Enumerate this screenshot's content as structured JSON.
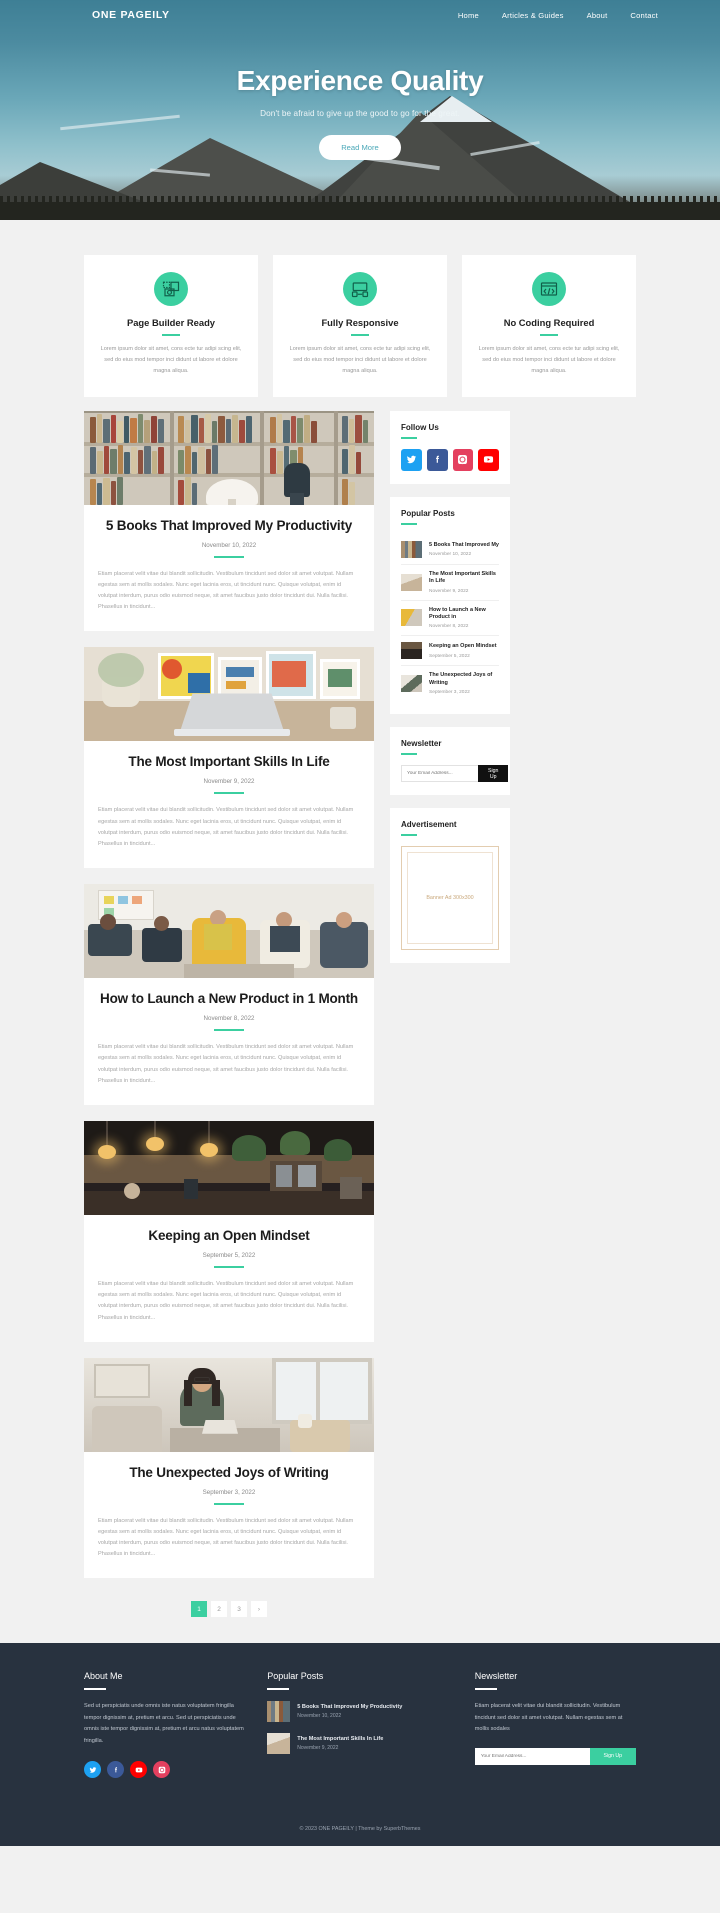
{
  "site": {
    "brand": "ONE PAGEILY"
  },
  "nav": {
    "items": [
      {
        "label": "Home"
      },
      {
        "label": "Articles & Guides"
      },
      {
        "label": "About"
      },
      {
        "label": "Contact"
      }
    ]
  },
  "hero": {
    "title": "Experience Quality",
    "subtitle": "Don't be afraid to give up the good to go for the great.",
    "button": "Read More"
  },
  "features": [
    {
      "icon": "page-builder-icon",
      "title": "Page Builder Ready",
      "text": "Lorem ipsum dolor sit amet, cons ecte tur adipi scing elit, sed do eius mod tempor inci didunt ut labore et dolore magna aliqua."
    },
    {
      "icon": "responsive-devices-icon",
      "title": "Fully Responsive",
      "text": "Lorem ipsum dolor sit amet, cons ecte tur adipi scing elit, sed do eius mod tempor inci didunt ut labore et dolore magna aliqua."
    },
    {
      "icon": "no-code-icon",
      "title": "No Coding Required",
      "text": "Lorem ipsum dolor sit amet, cons ecte tur adipi scing elit, sed do eius mod tempor inci didunt ut labore et dolore magna aliqua."
    }
  ],
  "excerpt": "Etiam placerat velit vitae dui blandit sollicitudin. Vestibulum tincidunt sed dolor sit amet volutpat. Nullam egestas sem at mollis sodales. Nunc eget lacinia eros, ut tincidunt nunc. Quisque volutpat, enim id volutpat interdum, purus odio euismod neque, sit amet faucibus justo dolor tincidunt dui. Nulla facilisi. Phasellus in tincidunt...",
  "posts": [
    {
      "title": "5 Books That Improved My Productivity",
      "date": "November 10, 2022",
      "image": "bookshelf-library-photo"
    },
    {
      "title": "The Most Important Skills In Life",
      "date": "November 9, 2022",
      "image": "desk-laptop-artwork-photo"
    },
    {
      "title": "How to Launch a New Product in 1 Month",
      "date": "November 8, 2022",
      "image": "team-meeting-office-photo"
    },
    {
      "title": "Keeping an Open Mindset",
      "date": "September 5, 2022",
      "image": "cafe-interior-photo"
    },
    {
      "title": "The Unexpected Joys of Writing",
      "date": "September 3, 2022",
      "image": "woman-writing-desk-photo"
    }
  ],
  "pagination": {
    "pages": [
      "1",
      "2",
      "3",
      "›"
    ],
    "active": "1"
  },
  "sidebar": {
    "follow": {
      "title": "Follow Us",
      "socials": [
        {
          "name": "twitter-icon",
          "color": "#1da1f2"
        },
        {
          "name": "facebook-icon",
          "color": "#3b5998"
        },
        {
          "name": "instagram-icon",
          "color": "#e4405f"
        },
        {
          "name": "youtube-icon",
          "color": "#ff0000"
        }
      ]
    },
    "popular": {
      "title": "Popular Posts",
      "items": [
        {
          "title": "5 Books That Improved My",
          "date": "November 10, 2022"
        },
        {
          "title": "The Most Important Skills In Life",
          "date": "November 9, 2022"
        },
        {
          "title": "How to Launch a New Product in",
          "date": "November 8, 2022"
        },
        {
          "title": "Keeping an Open Mindset",
          "date": "September 5, 2022"
        },
        {
          "title": "The Unexpected Joys of Writing",
          "date": "September 3, 2022"
        }
      ]
    },
    "newsletter": {
      "title": "Newsletter",
      "placeholder": "Your Email Address...",
      "button": "Sign Up"
    },
    "advertisement": {
      "title": "Advertisement",
      "banner_text": "Banner Ad 300x300"
    }
  },
  "footer": {
    "about": {
      "title": "About Me",
      "text": "Sed ut perspiciatis unde omnis iste natus voluptatem fringilla tempor dignissim at, pretium et arcu. Sed ut perspiciatis unde omnis iste tempor dignissim at, pretium et arcu natus voluptatem fringilla.",
      "socials": [
        {
          "name": "twitter-icon",
          "color": "#1da1f2"
        },
        {
          "name": "facebook-icon",
          "color": "#3b5998"
        },
        {
          "name": "youtube-icon",
          "color": "#ff0000"
        },
        {
          "name": "instagram-icon",
          "color": "#e4405f"
        }
      ]
    },
    "popular": {
      "title": "Popular Posts",
      "items": [
        {
          "title": "5 Books That Improved My Productivity",
          "date": "November 10, 2022"
        },
        {
          "title": "The Most Important Skills In Life",
          "date": "November 9, 2022"
        }
      ]
    },
    "newsletter": {
      "title": "Newsletter",
      "text": "Etiam placerat velit vitae dui blandit sollicitudin. Vestibulum tincidunt sed dolor sit amet volutpat. Nullam egestas sem at mollis sodales",
      "placeholder": "Your Email Address...",
      "button": "Sign Up"
    },
    "copyright": "© 2023 ONE PAGEILY | Theme by SuperbThemes"
  },
  "colors": {
    "accent": "#3bcfa0",
    "footer_bg": "#28323f",
    "dark": "#111111"
  }
}
